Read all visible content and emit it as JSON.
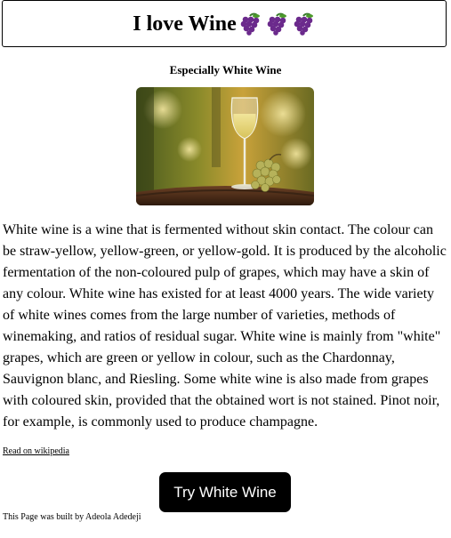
{
  "header": {
    "title": "I love Wine",
    "icons": [
      "grapes-icon",
      "grapes-icon",
      "grapes-icon"
    ],
    "grape_color": "#6b2a8c"
  },
  "subtitle": "Especially White Wine",
  "photo": {
    "description_icon": "white-wine-glass-image"
  },
  "body": {
    "paragraph": "White wine is a wine that is fermented without skin contact. The colour can be straw-yellow, yellow-green, or yellow-gold. It is produced by the alcoholic fermentation of the non-coloured pulp of grapes, which may have a skin of any colour. White wine has existed for at least 4000 years. The wide variety of white wines comes from the large number of varieties, methods of winemaking, and ratios of residual sugar. White wine is mainly from \"white\" grapes, which are green or yellow in colour, such as the Chardonnay, Sauvignon blanc, and Riesling. Some white wine is also made from grapes with coloured skin, provided that the obtained wort is not stained. Pinot noir, for example, is commonly used to produce champagne."
  },
  "links": {
    "wiki_label": "Read on wikipedia"
  },
  "cta": {
    "label": "Try White Wine",
    "background": "#000000",
    "text_color": "#ffffff"
  },
  "footer": {
    "credit": "This Page was built by Adeola Adedeji"
  }
}
